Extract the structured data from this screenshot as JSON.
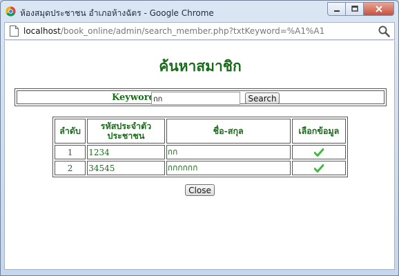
{
  "window": {
    "title": "ห้องสมุดประชาชน อำเภอห้างฉัตร - Google Chrome",
    "minimize_label": "▭",
    "maximize_label": "▣",
    "close_label": "✕"
  },
  "address": {
    "host": "localhost",
    "path": "/book_online/admin/search_member.php?txtKeyword=%A1%A1"
  },
  "page": {
    "title": "ค้นหาสมาชิก",
    "search": {
      "label": "Keyword",
      "value": "กก",
      "button": "Search"
    },
    "table": {
      "headers": {
        "no": "ลำดับ",
        "id_line1": "รหัสประจำตัว",
        "id_line2": "ประชาชน",
        "name": "ชื่อ-สกุล",
        "select": "เลือกข้อมูล"
      },
      "rows": [
        {
          "no": "1",
          "id": "1234",
          "name": "กก"
        },
        {
          "no": "2",
          "id": "34545",
          "name": "กกกกกก"
        }
      ]
    },
    "close_button": "Close"
  },
  "colors": {
    "accent_green": "#1a6b1a",
    "check_green": "#3fb93f"
  }
}
